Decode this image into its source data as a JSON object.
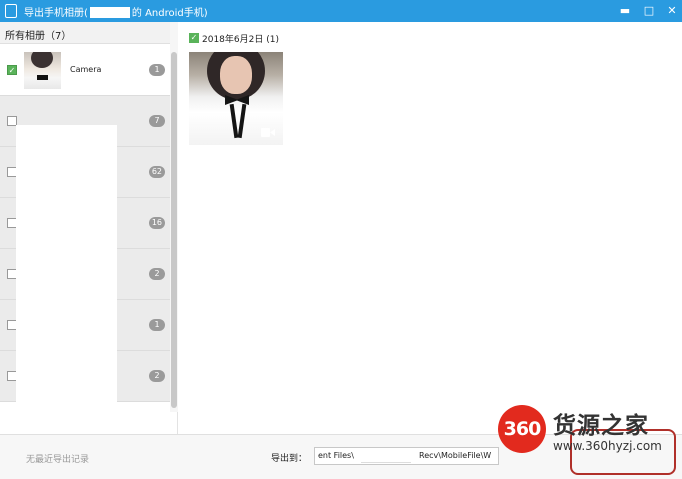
{
  "window": {
    "title_prefix": "导出手机相册(",
    "title_suffix": "的 Android手机)",
    "minimize_glyph": "▬",
    "maximize_glyph": "□",
    "close_glyph": "✕"
  },
  "sidebar": {
    "header": "所有相册（7）",
    "albums": [
      {
        "name": "Camera",
        "count": "1",
        "checked": true
      },
      {
        "name": "",
        "count": "7",
        "checked": false
      },
      {
        "name": "",
        "count": "62",
        "checked": false
      },
      {
        "name": "",
        "count": "16",
        "checked": false
      },
      {
        "name": "",
        "count": "2",
        "checked": false
      },
      {
        "name": "",
        "count": "1",
        "checked": false
      },
      {
        "name": "",
        "count": "2",
        "checked": false
      }
    ]
  },
  "main": {
    "date_group_label": "2018年6月2日 (1)",
    "checkmark": "✓"
  },
  "footer": {
    "no_record": "无最近导出记录",
    "export_label": "导出到：",
    "path_left": "ent Files\\",
    "path_right": "Recv\\MobileFile\\W"
  },
  "watermark": {
    "logo": "360",
    "brand": "货源之家",
    "url": "www.360hyzj.com"
  },
  "colors": {
    "titlebar": "#2a9be0",
    "checkbox_checked": "#5ab35a",
    "count_badge": "#9a9a9a",
    "watermark_red": "#e22a1e"
  }
}
